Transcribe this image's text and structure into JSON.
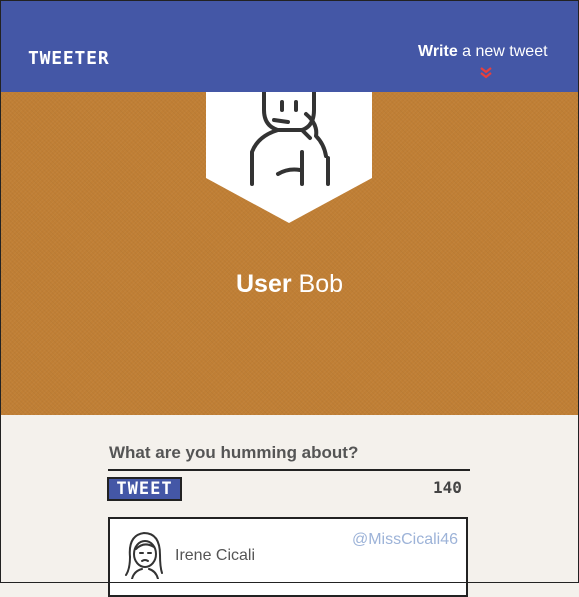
{
  "nav": {
    "logo": "TWEETER",
    "write_bold": "Write",
    "write_rest": " a new tweet"
  },
  "profile": {
    "title_bold": "User",
    "title_rest": " Bob",
    "avatar_icon": "user-avatar-icon"
  },
  "compose": {
    "prompt": "What are you humming about?",
    "button_label": "TWEET",
    "remaining": "140"
  },
  "tweets": [
    {
      "name": "Irene Cicali",
      "handle": "@MissCicali46",
      "avatar_icon": "female-avatar-icon"
    }
  ],
  "colors": {
    "nav": "#4457a6",
    "banner": "#c07f35",
    "accent_chevron": "#e8403c",
    "handle": "#9db3d8",
    "page_bg": "#f4f1ec"
  }
}
